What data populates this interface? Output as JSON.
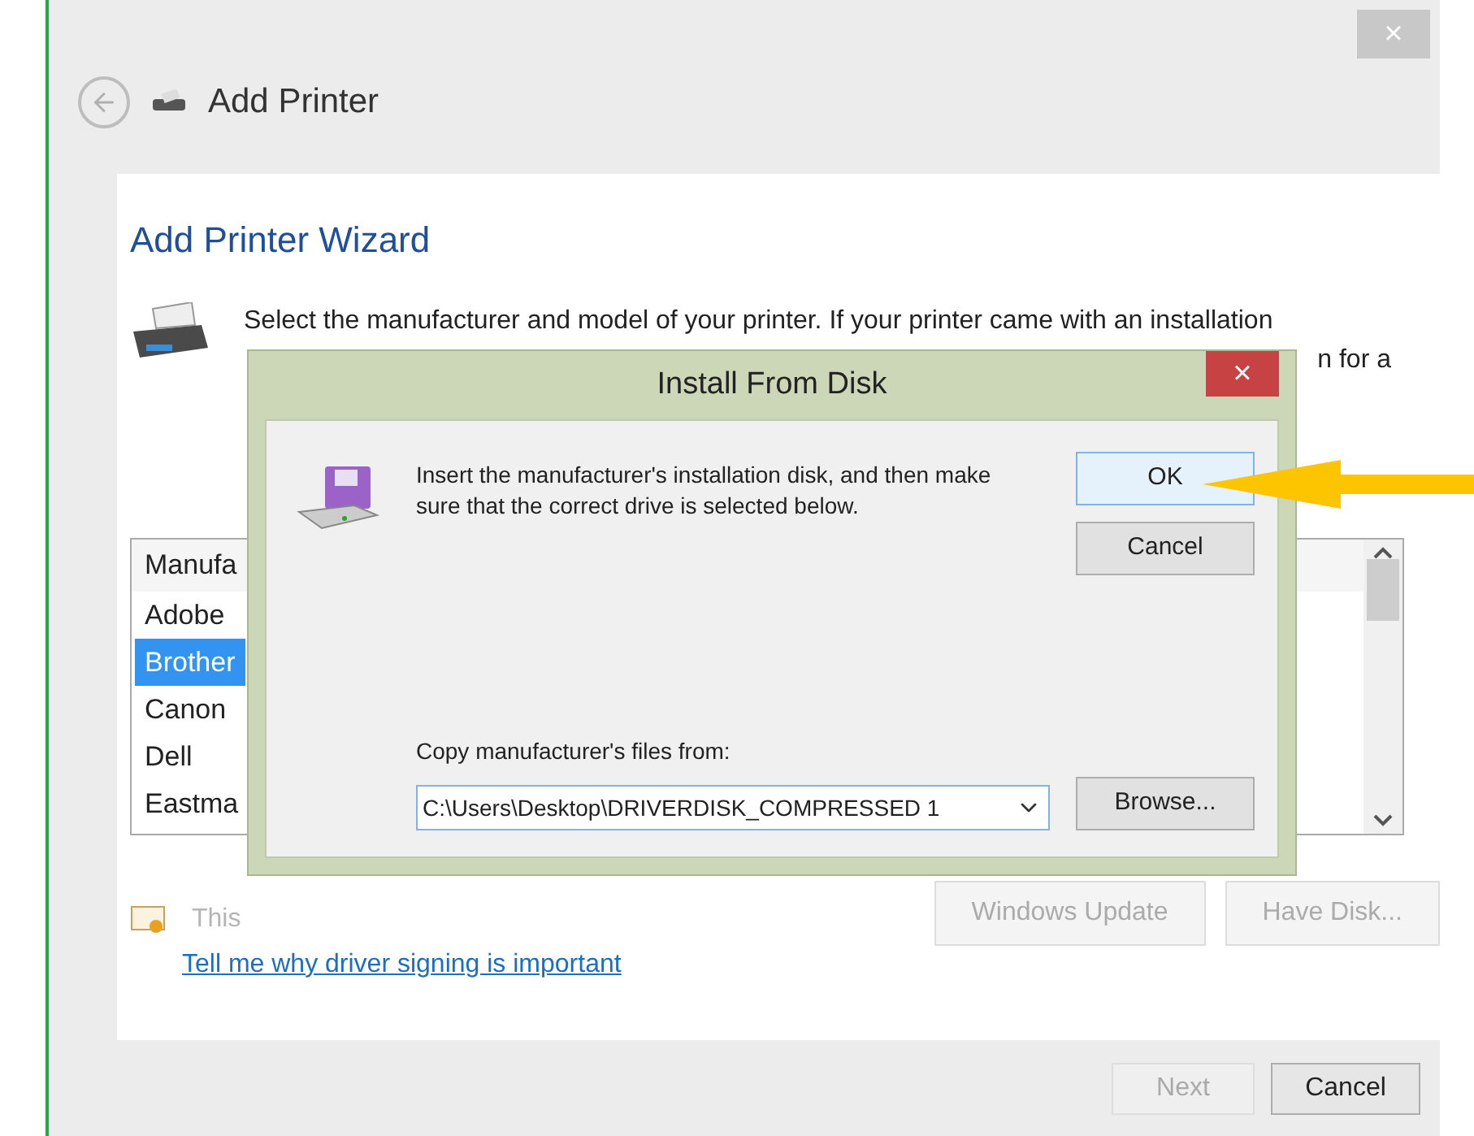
{
  "window": {
    "title": "Add Printer",
    "close": "×"
  },
  "wizard": {
    "heading": "Add Printer Wizard",
    "description_line_1": "Select the manufacturer and model of your printer. If your printer came with an installation",
    "description_line_2_visible": "n for a"
  },
  "manufacturers": {
    "header": "Manufa",
    "items": [
      {
        "label": "Adobe",
        "selected": false
      },
      {
        "label": "Brother",
        "selected": true
      },
      {
        "label": "Canon",
        "selected": false
      },
      {
        "label": "Dell",
        "selected": false
      },
      {
        "label": "Eastma",
        "selected": false
      }
    ]
  },
  "signing": {
    "status_visible": "This",
    "link": "Tell me why driver signing is important"
  },
  "list_buttons": [
    "Windows Update",
    "Have Disk..."
  ],
  "footer": {
    "buttons": [
      {
        "label": "Next",
        "disabled": true
      },
      {
        "label": "Cancel",
        "disabled": false
      }
    ]
  },
  "dialog": {
    "title": "Install From Disk",
    "close": "×",
    "message": "Insert the manufacturer's installation disk, and then make sure that the correct drive is selected below.",
    "copy_label": "Copy manufacturer's files from:",
    "path_value": "C:\\Users\\Desktop\\DRIVERDISK_COMPRESSED 1",
    "buttons": [
      {
        "label": "OK",
        "focused": true
      },
      {
        "label": "Cancel",
        "focused": false
      }
    ],
    "browse": "Browse..."
  }
}
